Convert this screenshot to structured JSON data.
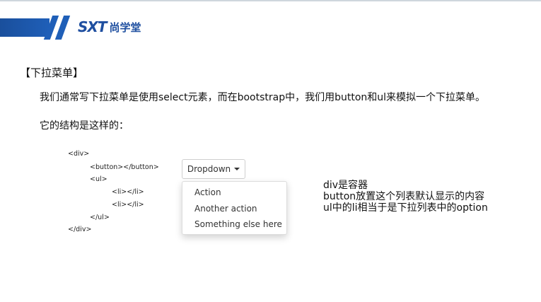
{
  "header": {
    "logo_mark": "SXT",
    "logo_text": "尚学堂",
    "accent_color": "#1f5fb8"
  },
  "slide": {
    "section_title": "【下拉菜单】",
    "paragraph_1": "我们通常写下拉菜单是使用select元素，而在bootstrap中，我们用button和ul来模拟一个下拉菜单。",
    "paragraph_2": "它的结构是这样的："
  },
  "code_sample": {
    "lines": [
      "<div>",
      "<button></button>",
      "<ul>",
      "<li></li>",
      "<li></li>",
      "</ul>",
      "</div>"
    ]
  },
  "dropdown_demo": {
    "button_label": "Dropdown",
    "items": [
      "Action",
      "Another action",
      "Something else here"
    ]
  },
  "notes": {
    "lines": [
      "div是容器",
      "button放置这个列表默认显示的内容",
      "ul中的li相当于是下拉列表中的option"
    ]
  }
}
